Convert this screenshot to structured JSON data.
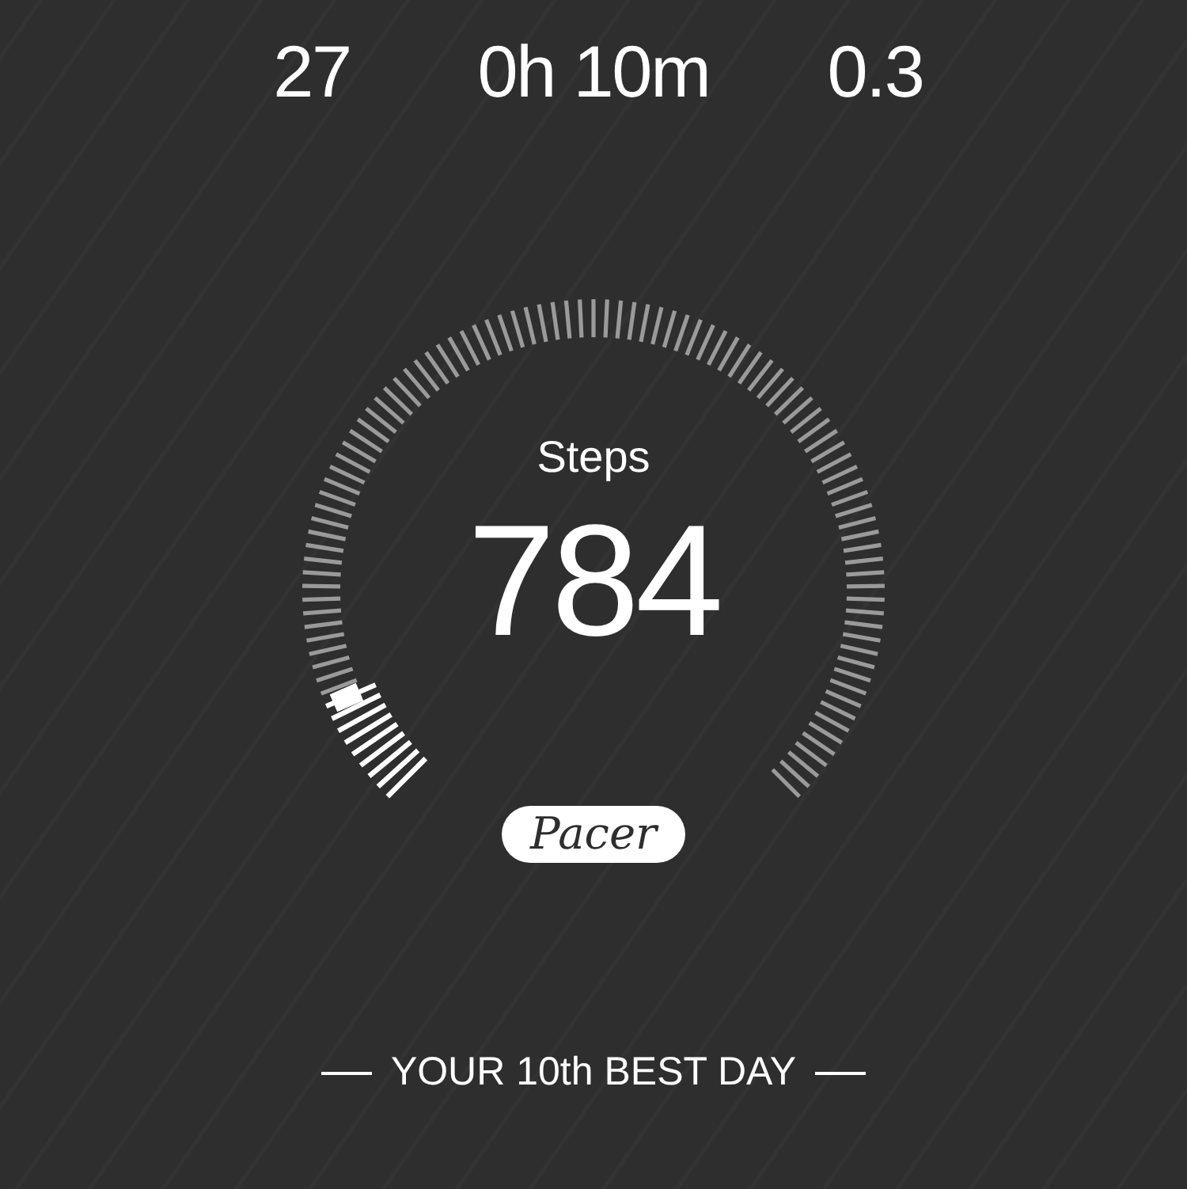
{
  "stats": [
    {
      "value": "27"
    },
    {
      "value": "0h 10m"
    },
    {
      "value": "0.3"
    }
  ],
  "gauge": {
    "label": "Steps",
    "value": "784"
  },
  "logo": {
    "text": "Pacer"
  },
  "ranking": {
    "text": "YOUR 10th BEST DAY"
  }
}
